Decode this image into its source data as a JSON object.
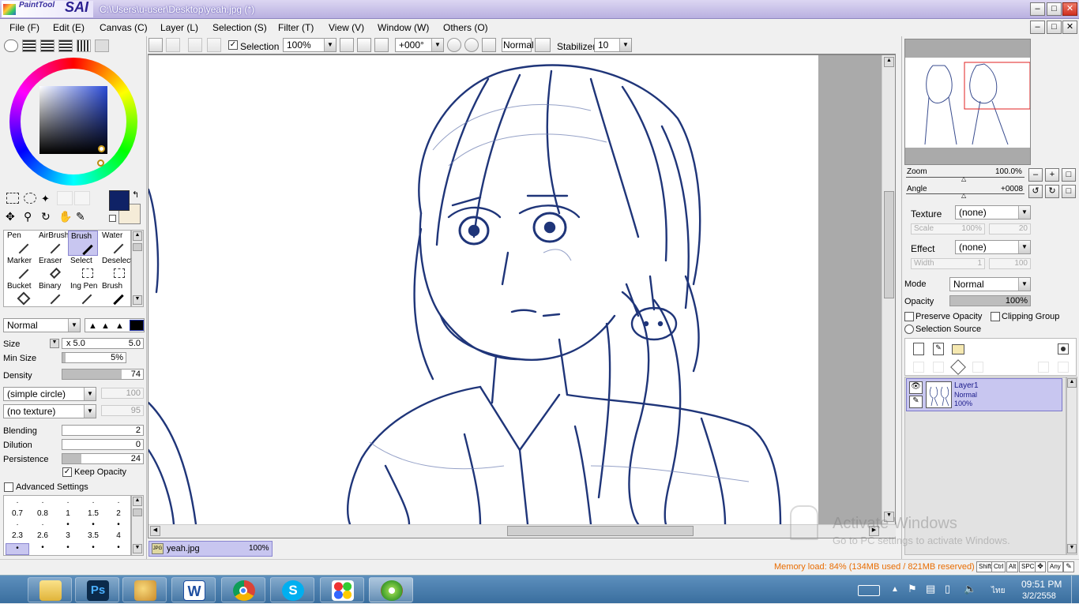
{
  "app": {
    "title": "C:\\Users\\u-user\\Desktop\\yeah.jpg (*)",
    "logo_small": "PaintTool",
    "logo_big": "SAI"
  },
  "menu": [
    "File (F)",
    "Edit (E)",
    "Canvas (C)",
    "Layer (L)",
    "Selection (S)",
    "Filter (T)",
    "View (V)",
    "Window (W)",
    "Others (O)"
  ],
  "toolbar": {
    "selection_label": "Selection",
    "zoom": "100%",
    "angle": "+000°",
    "blend": "Normal",
    "stabilizer_label": "Stabilizer",
    "stabilizer_value": "10"
  },
  "colors": {
    "primary": "#0f2266",
    "secondary": "#f5ecd8",
    "accent": "#c8c6f0"
  },
  "tools": [
    {
      "label": "Pen",
      "icon": "pen-icon"
    },
    {
      "label": "AirBrush",
      "icon": "airbrush-icon"
    },
    {
      "label": "Brush",
      "icon": "brush-icon",
      "selected": true
    },
    {
      "label": "Water",
      "icon": "water-icon"
    },
    {
      "label": "Marker",
      "icon": "marker-icon"
    },
    {
      "label": "Eraser",
      "icon": "eraser-icon"
    },
    {
      "label": "Select",
      "icon": "select-icon"
    },
    {
      "label": "Deselect",
      "icon": "deselect-icon"
    },
    {
      "label": "Bucket",
      "icon": "bucket-icon"
    },
    {
      "label": "Binary",
      "icon": "binary-icon"
    },
    {
      "label": "Ing Pen",
      "icon": "ink-pen-icon"
    },
    {
      "label": "Brush",
      "icon": "brush-icon"
    }
  ],
  "brush": {
    "mode": "Normal",
    "size_label": "Size",
    "size_mult": "x 5.0",
    "size_value": "5.0",
    "minsize_label": "Min Size",
    "minsize_value": "5%",
    "density_label": "Density",
    "density_value": "74",
    "density_fraction": 0.74,
    "shape": "(simple circle)",
    "shape_value": "100",
    "texture": "(no texture)",
    "texture_value": "95",
    "blending_label": "Blending",
    "blending_value": "2",
    "dilution_label": "Dilution",
    "dilution_value": "0",
    "persistence_label": "Persistence",
    "persistence_value": "24",
    "persistence_fraction": 0.24,
    "keep_opacity": "Keep Opacity",
    "advanced": "Advanced Settings",
    "sizes_row1": [
      "0.7",
      "0.8",
      "1",
      "1.5",
      "2"
    ],
    "sizes_row2": [
      "2.3",
      "2.6",
      "3",
      "3.5",
      "4"
    ]
  },
  "navigator": {
    "zoom_label": "Zoom",
    "zoom_value": "100.0%",
    "angle_label": "Angle",
    "angle_value": "+0008"
  },
  "layer_props": {
    "texture_label": "Texture",
    "texture_value": "(none)",
    "scale_label": "Scale",
    "scale_value": "100%",
    "scale_value2": "20",
    "effect_label": "Effect",
    "effect_value": "(none)",
    "width_label": "Width",
    "width_value": "1",
    "width_value2": "100",
    "mode_label": "Mode",
    "mode_value": "Normal",
    "opacity_label": "Opacity",
    "opacity_value": "100%",
    "preserve_opacity": "Preserve Opacity",
    "clipping_group": "Clipping Group",
    "selection_source": "Selection Source"
  },
  "layers": [
    {
      "name": "Layer1",
      "mode": "Normal",
      "opacity": "100%"
    }
  ],
  "file_tab": {
    "badge": "JPG",
    "name": "yeah.jpg",
    "zoom": "100%"
  },
  "status": {
    "memory": "Memory load: 84% (134MB used / 821MB reserved)",
    "keys": [
      "Shift",
      "Ctrl",
      "Alt",
      "SPC",
      "Any"
    ]
  },
  "watermark": {
    "line1": "Activate Windows",
    "line2": "Go to PC settings to activate Windows."
  },
  "taskbar": {
    "apps": [
      "file-explorer-icon",
      "photoshop-icon",
      "paint-icon",
      "word-icon",
      "chrome-icon",
      "skype-icon",
      "games-icon",
      "painttool-sai-icon"
    ],
    "ps_label": "Ps",
    "word_label": "W",
    "skype_label": "S",
    "lang": "ไทย",
    "time": "09:51 PM",
    "date": "3/2/2558"
  }
}
